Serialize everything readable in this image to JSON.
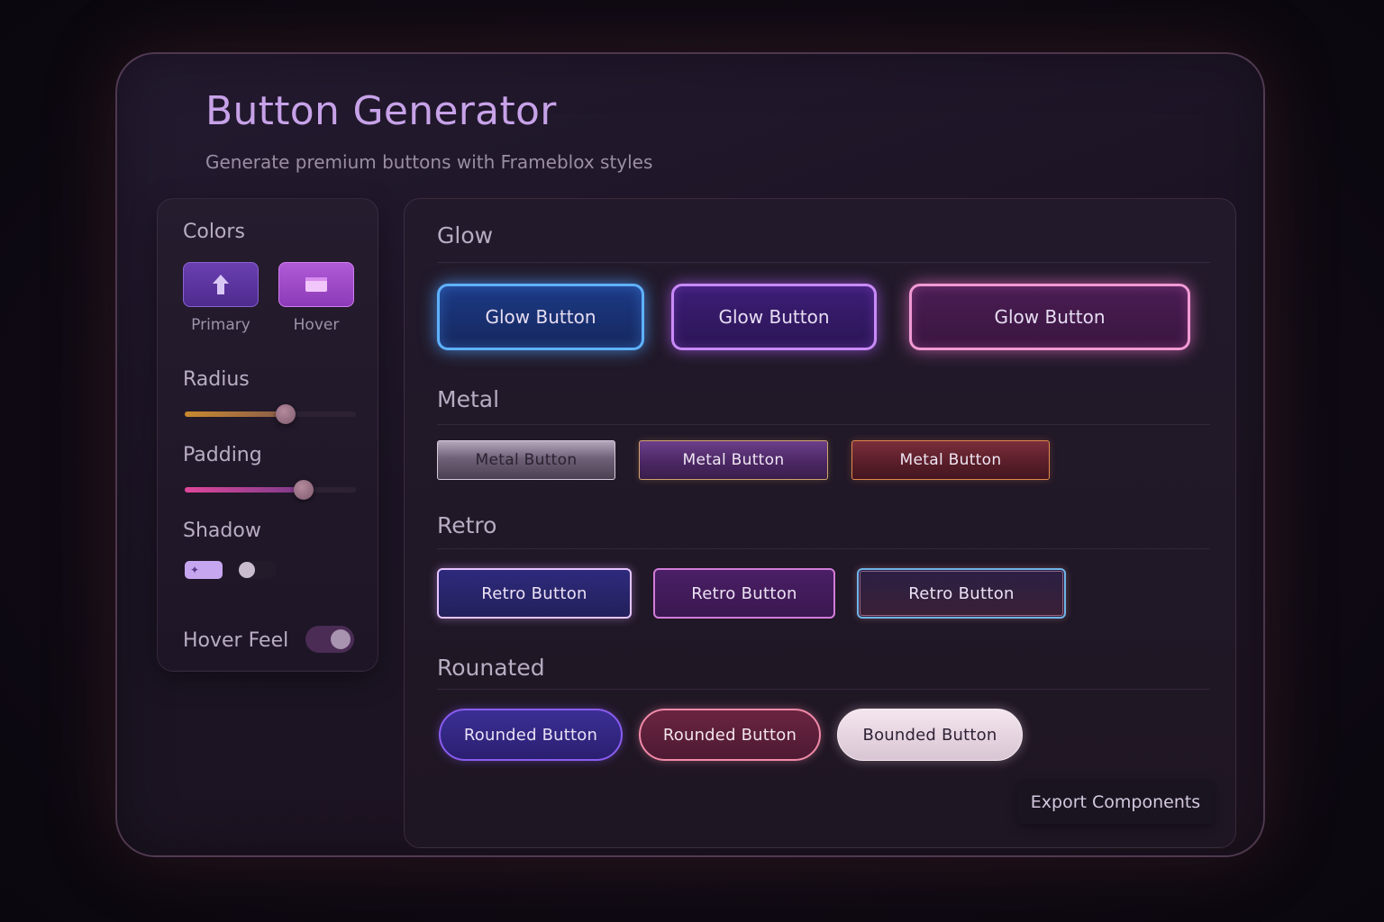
{
  "header": {
    "title": "Button Generator",
    "subtitle": "Generate premium buttons with Frameblox styles"
  },
  "sidebar": {
    "colors_label": "Colors",
    "swatches": [
      {
        "caption": "Primary",
        "color": "#5b34a0",
        "icon": "arrow-up-icon"
      },
      {
        "caption": "Hover",
        "color": "#a24bcc",
        "icon": "window-icon"
      }
    ],
    "radius": {
      "label": "Radius",
      "value_percent": 59
    },
    "padding": {
      "label": "Padding",
      "value_percent": 70
    },
    "shadow": {
      "label": "Shadow"
    },
    "hover_feel": {
      "label": "Hover Feel",
      "enabled": true
    }
  },
  "sections": {
    "glow": {
      "label": "Glow",
      "buttons": [
        "Glow Button",
        "Glow Button",
        "Glow Button"
      ]
    },
    "metal": {
      "label": "Metal",
      "buttons": [
        "Metal Button",
        "Metal Button",
        "Metal Button"
      ]
    },
    "retro": {
      "label": "Retro",
      "buttons": [
        "Retro Button",
        "Retro Button",
        "Retro Button"
      ]
    },
    "rounded": {
      "label": "Rounated",
      "buttons": [
        "Rounded Button",
        "Rounded Button",
        "Bounded Button"
      ]
    }
  },
  "export_label": "Export Components",
  "colors": {
    "accent": "#c7a2e8",
    "glow_blue": "#5fb2ff",
    "glow_purple": "#c98af8",
    "glow_pink": "#f19ad4"
  }
}
